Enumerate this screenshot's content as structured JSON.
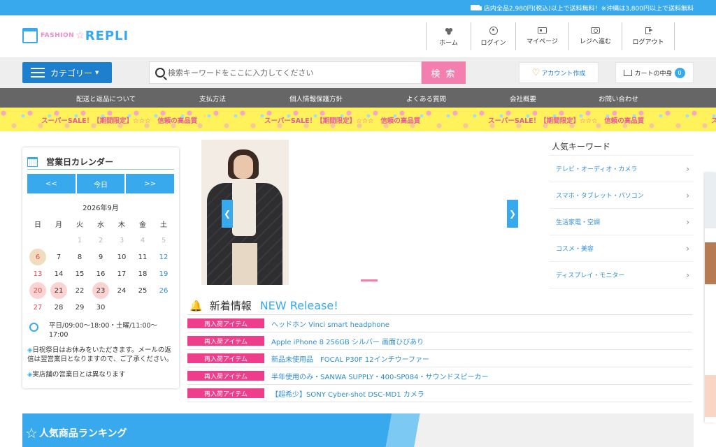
{
  "topbar": {
    "shipping_note": "店内全品2,980円(税込)以上で送料無料！※沖縄は3,800円以上で送料無料"
  },
  "logo": {
    "fashion": "FASHION",
    "star": "☆",
    "brand": "REPLI"
  },
  "nav": [
    {
      "label": "ホーム",
      "icon": "home-icon"
    },
    {
      "label": "ログイン",
      "icon": "user-icon"
    },
    {
      "label": "マイページ",
      "icon": "id-card-icon"
    },
    {
      "label": "レジへ進む",
      "icon": "register-icon"
    },
    {
      "label": "ログアウト",
      "icon": "logout-icon"
    }
  ],
  "search": {
    "category_label": "カテゴリー",
    "placeholder": "検索キーワードをここに入力してください",
    "button_label": "検 索",
    "account_label": "アカウント作成",
    "cart_label": "カートの中身",
    "cart_count": "0"
  },
  "menu": [
    "配送と返品について",
    "支払方法",
    "個人情報保護方針",
    "よくある質問",
    "会社概要",
    "お問い合わせ"
  ],
  "banner": {
    "sale_text": "スーパーSALE！【期間限定】☆☆☆",
    "quality_text": "信頼の高品質"
  },
  "calendar": {
    "title": "営業日カレンダー",
    "prev": "<<",
    "today": "今日",
    "next": ">>",
    "month": "2026年9月",
    "weekdays": [
      "日",
      "月",
      "火",
      "水",
      "木",
      "金",
      "土"
    ],
    "days": [
      {
        "d": "",
        "s": ""
      },
      {
        "d": "",
        "s": ""
      },
      {
        "d": "1",
        "s": "past"
      },
      {
        "d": "2",
        "s": "past"
      },
      {
        "d": "3",
        "s": "past"
      },
      {
        "d": "4",
        "s": "past"
      },
      {
        "d": "5",
        "s": "past"
      },
      {
        "d": "6",
        "s": "today"
      },
      {
        "d": "7",
        "s": ""
      },
      {
        "d": "8",
        "s": ""
      },
      {
        "d": "9",
        "s": ""
      },
      {
        "d": "10",
        "s": ""
      },
      {
        "d": "11",
        "s": ""
      },
      {
        "d": "12",
        "s": "sat"
      },
      {
        "d": "13",
        "s": "sun"
      },
      {
        "d": "14",
        "s": ""
      },
      {
        "d": "15",
        "s": ""
      },
      {
        "d": "16",
        "s": ""
      },
      {
        "d": "17",
        "s": ""
      },
      {
        "d": "18",
        "s": ""
      },
      {
        "d": "19",
        "s": "sat"
      },
      {
        "d": "20",
        "s": "hol"
      },
      {
        "d": "21",
        "s": "hol"
      },
      {
        "d": "22",
        "s": ""
      },
      {
        "d": "23",
        "s": "hol"
      },
      {
        "d": "24",
        "s": ""
      },
      {
        "d": "25",
        "s": ""
      },
      {
        "d": "26",
        "s": "sat"
      },
      {
        "d": "27",
        "s": "sun"
      },
      {
        "d": "28",
        "s": ""
      },
      {
        "d": "29",
        "s": ""
      },
      {
        "d": "30",
        "s": ""
      },
      {
        "d": "",
        "s": ""
      },
      {
        "d": "",
        "s": ""
      },
      {
        "d": "",
        "s": ""
      }
    ],
    "hours": "平日/09:00～18:00・土曜/11:00～17:00",
    "note1_mark": "◈",
    "note1": "日祝祭日はお休みをいただきます。メールの返信は翌営業日となりますので、ご了承ください。",
    "note2_mark": "◈",
    "note2": "実店舗の営業日とは異なります"
  },
  "slider": {
    "prev": "❮",
    "next": "❯"
  },
  "keywords": {
    "title": "人気キーワード",
    "items": [
      "テレビ・オーディオ・カメラ",
      "スマホ・タブレット・パソコン",
      "生活家電・空調",
      "コスメ・美容",
      "ディスプレイ・モニター"
    ]
  },
  "news": {
    "title": "新着情報",
    "subtitle": "NEW Release!",
    "items": [
      {
        "tag": "再入荷アイテム",
        "text": "ヘッドホン Vinci smart headphone"
      },
      {
        "tag": "再入荷アイテム",
        "text": "Apple iPhone 8 256GB シルバー 画面ひびあり"
      },
      {
        "tag": "再入荷アイテム",
        "text": "新品未使用品　FOCAL P30F 12インチウーファー"
      },
      {
        "tag": "再入荷アイテム",
        "text": "半年使用のみ・SANWA SUPPLY・400-SP084・サウンドスピーカー"
      },
      {
        "tag": "再入荷アイテム",
        "text": "【超希少】SONY Cyber-shot DSC-MD1 カメラ"
      }
    ]
  },
  "ranking": {
    "title": "人気商品ランキング"
  },
  "colors": {
    "accent": "#38a9ec",
    "pink": "#f27fae",
    "tag": "#ee3d8a",
    "menu": "#666666"
  }
}
